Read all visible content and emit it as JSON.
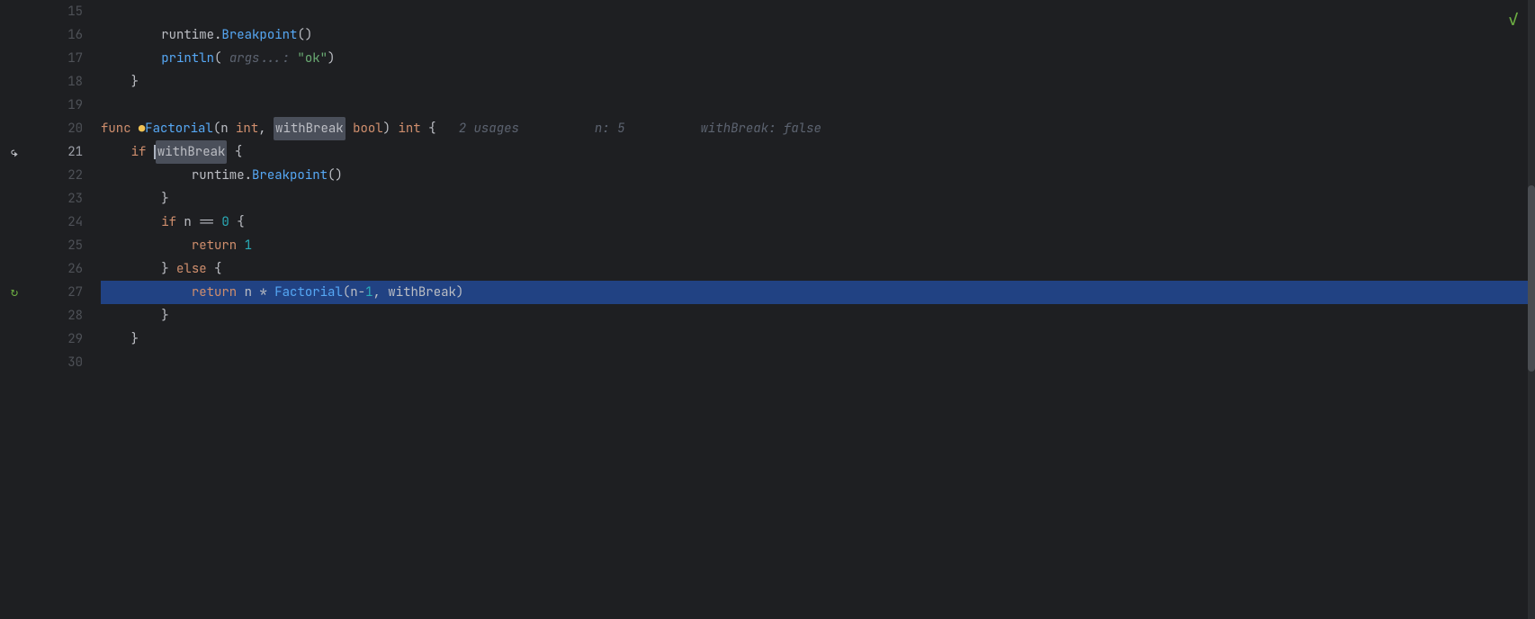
{
  "editor": {
    "lines": [
      {
        "num": 15,
        "content": [],
        "type": "normal"
      },
      {
        "num": 16,
        "indent": 2,
        "content": "runtime.Breakpoint()",
        "type": "normal"
      },
      {
        "num": 17,
        "indent": 2,
        "content": "println( args...: \"ok\")",
        "type": "normal"
      },
      {
        "num": 18,
        "indent": 1,
        "content": "}",
        "type": "normal"
      },
      {
        "num": 19,
        "content": "",
        "type": "normal"
      },
      {
        "num": 20,
        "content": "func factorial(n int, withBreak bool) int {",
        "type": "funcdef",
        "hint_n": "n: 5",
        "hint_wb": "withBreak: false",
        "usages": "2 usages"
      },
      {
        "num": 21,
        "content": "if withBreak {",
        "type": "ifline",
        "arrow": true
      },
      {
        "num": 22,
        "indent": 3,
        "content": "runtime.Breakpoint()",
        "type": "normal"
      },
      {
        "num": 23,
        "indent": 2,
        "content": "}",
        "type": "normal"
      },
      {
        "num": 24,
        "indent": 2,
        "content": "if n == 0 {",
        "type": "normal"
      },
      {
        "num": 25,
        "indent": 3,
        "content": "return 1",
        "type": "normal"
      },
      {
        "num": 26,
        "indent": 2,
        "content": "} else {",
        "type": "normal"
      },
      {
        "num": 27,
        "content": "return n * Factorial(n-1, withBreak)",
        "type": "highlighted",
        "breakpoint": true
      },
      {
        "num": 28,
        "indent": 2,
        "content": "}",
        "type": "normal"
      },
      {
        "num": 29,
        "indent": 1,
        "content": "}",
        "type": "normal"
      },
      {
        "num": 30,
        "content": "",
        "type": "normal"
      }
    ],
    "checkmark": "✓"
  }
}
